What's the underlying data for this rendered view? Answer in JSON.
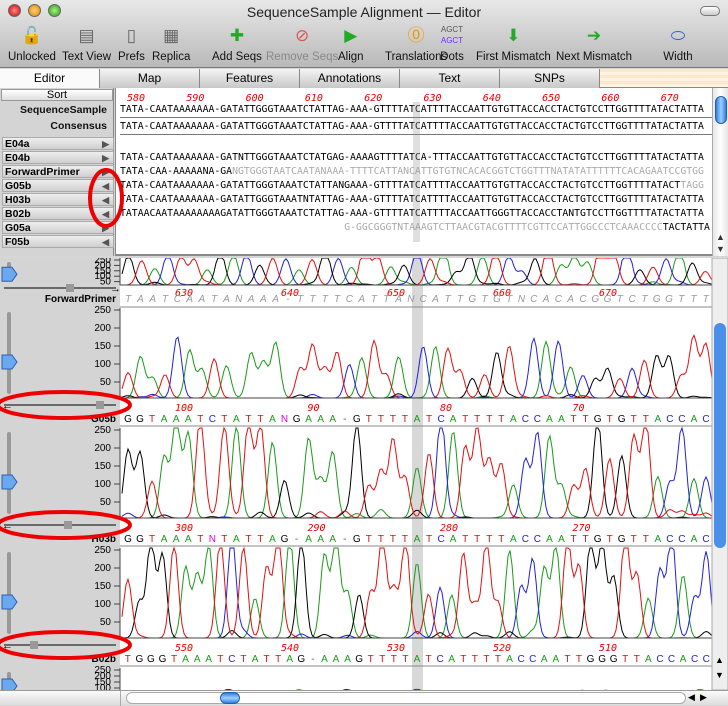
{
  "window": {
    "title": "SequenceSample Alignment — Editor"
  },
  "toolbar": [
    {
      "label": "Unlocked",
      "icon": "unlocked-padlock-icon",
      "enabled": true
    },
    {
      "label": "Text View",
      "icon": "text-document-icon",
      "enabled": true
    },
    {
      "label": "Prefs",
      "icon": "switch-icon",
      "enabled": true
    },
    {
      "label": "Replica",
      "icon": "replica-calendar-icon",
      "enabled": true
    },
    {
      "label": "Add Seqs",
      "icon": "add-dna-icon",
      "enabled": true
    },
    {
      "label": "Remove Seqs",
      "icon": "prohibited-icon",
      "enabled": false
    },
    {
      "label": "Align",
      "icon": "play-icon",
      "enabled": true
    },
    {
      "label": "Translations",
      "icon": "translation-icon",
      "enabled": true
    },
    {
      "label": "Dots",
      "icon": "agct-icon",
      "enabled": true
    },
    {
      "label": "First Mismatch",
      "icon": "first-mismatch-icon",
      "enabled": true
    },
    {
      "label": "Next Mismatch",
      "icon": "next-mismatch-icon",
      "enabled": true
    },
    {
      "label": "Width",
      "icon": "width-slider-icon",
      "enabled": true
    }
  ],
  "dots_icon_text": "AGCT",
  "tabs": [
    "Editor",
    "Map",
    "Features",
    "Annotations",
    "Text",
    "SNPs"
  ],
  "active_tab": "Editor",
  "alignment": {
    "sort_label": "Sort",
    "ruler": [
      "580",
      "590",
      "600",
      "610",
      "620",
      "630",
      "640",
      "650",
      "660",
      "670"
    ],
    "reference": {
      "label": "SequenceSample",
      "seq": "TATA-CAATAAAAAAA-GATATTGGGTAAATCTATTAG-AAA-GTTTTATCATTTTACCAATTGTGTTACCACCTACTGTCCTTGGTTTTATACTATTA"
    },
    "consensus": {
      "label": "Consensus",
      "seq": "TATA-CAATAAAAAAA-GATATTGGGTAAATCTATTAG-AAA-GTTTTATCATTTTACCAATTGTGTTACCACCTACTGTCCTTGGTTTTATACTATTA"
    },
    "rows": [
      {
        "label": "E04a",
        "arrow": "right",
        "seq": "",
        "gray": "",
        "pad": 0
      },
      {
        "label": "E04b",
        "arrow": "right",
        "seq": "TATA-CAATAAAAAAA-GATNTTGGGTAAATCTATGAG-AAAAGTTTTATCA-TTTACCAATTGTGTTACCACCTACTGTCCTTGGTTTTATACTATTA",
        "gray": "",
        "pad": 0
      },
      {
        "label": "ForwardPrimer",
        "arrow": "right",
        "seq": "TATA-CAA-AAAAANA-GA",
        "gray": "NGTGGGTAATCAATANAAA-TTTTCATTANCATTGTGTNCACACGGTCTGGTTTNATATATTTTTTCACAGAATCCGTGG",
        "pad": 0
      },
      {
        "label": "G05b",
        "arrow": "left",
        "seq": "TATA-CAATAAAAAAA-GATATTGGGTAAATCTATTANGAAA-GTTTTATCATTTTACCAATTGTGTTACCACCTACTGTCCTTGGTTTTATACT",
        "gray": "TAGG",
        "pad": 0
      },
      {
        "label": "H03b",
        "arrow": "left",
        "seq": "TATA-CAATAAAAAAA-GATATTGGGTAAATNTATTAG-AAA-GTTTTATCATTTTACCAATTGTGTTACCACCTACTGTCCTTGGTTTTATACTATTA",
        "gray": "",
        "pad": 0
      },
      {
        "label": "B02b",
        "arrow": "left",
        "seq": "TATAACAATAAAAAAAAGATATTGGGTAAATCTATTAG-AAA-GTTTTATCATTTTACCAATTGGGTTACCACCTANTGTCCTTGGTTTTATACTATTA",
        "gray": "",
        "pad": 0
      },
      {
        "label": "G05a",
        "arrow": "right",
        "seq": "",
        "gray": "G-GGCGGGTNTAAAGTCTTAACGTACGTTTTCGTTCCATTGGCCCTCAAACCCC",
        "tail": "TACTATTA",
        "pad": 38
      },
      {
        "label": "F05b",
        "arrow": "left",
        "seq": "",
        "gray": "",
        "pad": 0
      }
    ]
  },
  "chromatograms": {
    "y_ticks": [
      "250",
      "200",
      "150",
      "100",
      "50"
    ],
    "base_colors": {
      "A": "#1a9a1a",
      "C": "#2020e0",
      "G": "#000000",
      "T": "#e01010",
      "N": "#e000e0",
      "-": "#555555"
    },
    "primer": {
      "label": "ForwardPrimer",
      "ruler": [
        "630",
        "640",
        "650",
        "660",
        "670"
      ],
      "bases": "TAATCAATANAAA-TTTTCATTANCATTGTGTNCACACGGTCTGGTTT"
    },
    "tracks": [
      {
        "label": "G05b",
        "ruler": [
          "100",
          "90",
          "80",
          "70"
        ],
        "bases": "GGTAAATCTATTANGAAA-GTTTTATCATTTTACCAATTGTGTTACCAC"
      },
      {
        "label": "H03b",
        "ruler": [
          "300",
          "290",
          "280",
          "270"
        ],
        "bases": "GGTAAATNTATTAG-AAA-GTTTTATCATTTTACCAATTGTGTTACCAC"
      },
      {
        "label": "B02b",
        "ruler": [
          "550",
          "540",
          "530",
          "520",
          "510"
        ],
        "bases": "TGGGTAAATCTATTAG-AAAGTTTTATCATTTTACCAATTGGGTTACCACC"
      }
    ]
  }
}
